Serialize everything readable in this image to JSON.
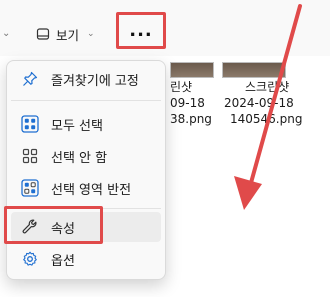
{
  "toolbar": {
    "view_label": "보기",
    "more_label": "..."
  },
  "files": [
    {
      "name": "린샷",
      "date": "09-18",
      "ext": "38.png"
    },
    {
      "name": "스크린샷",
      "date": "2024-09-18",
      "ext": "140546.png"
    }
  ],
  "menu": {
    "items": [
      {
        "label": "즐겨찾기에 고정",
        "icon": "pin-icon"
      },
      {
        "label": "모두 선택",
        "icon": "select-all-icon"
      },
      {
        "label": "선택 안 함",
        "icon": "select-none-icon"
      },
      {
        "label": "선택 영역 반전",
        "icon": "invert-selection-icon"
      },
      {
        "label": "속성",
        "icon": "wrench-icon"
      },
      {
        "label": "옵션",
        "icon": "gear-icon"
      }
    ]
  },
  "colors": {
    "annotation": "#e04a4a",
    "accent": "#1f6fd1"
  }
}
